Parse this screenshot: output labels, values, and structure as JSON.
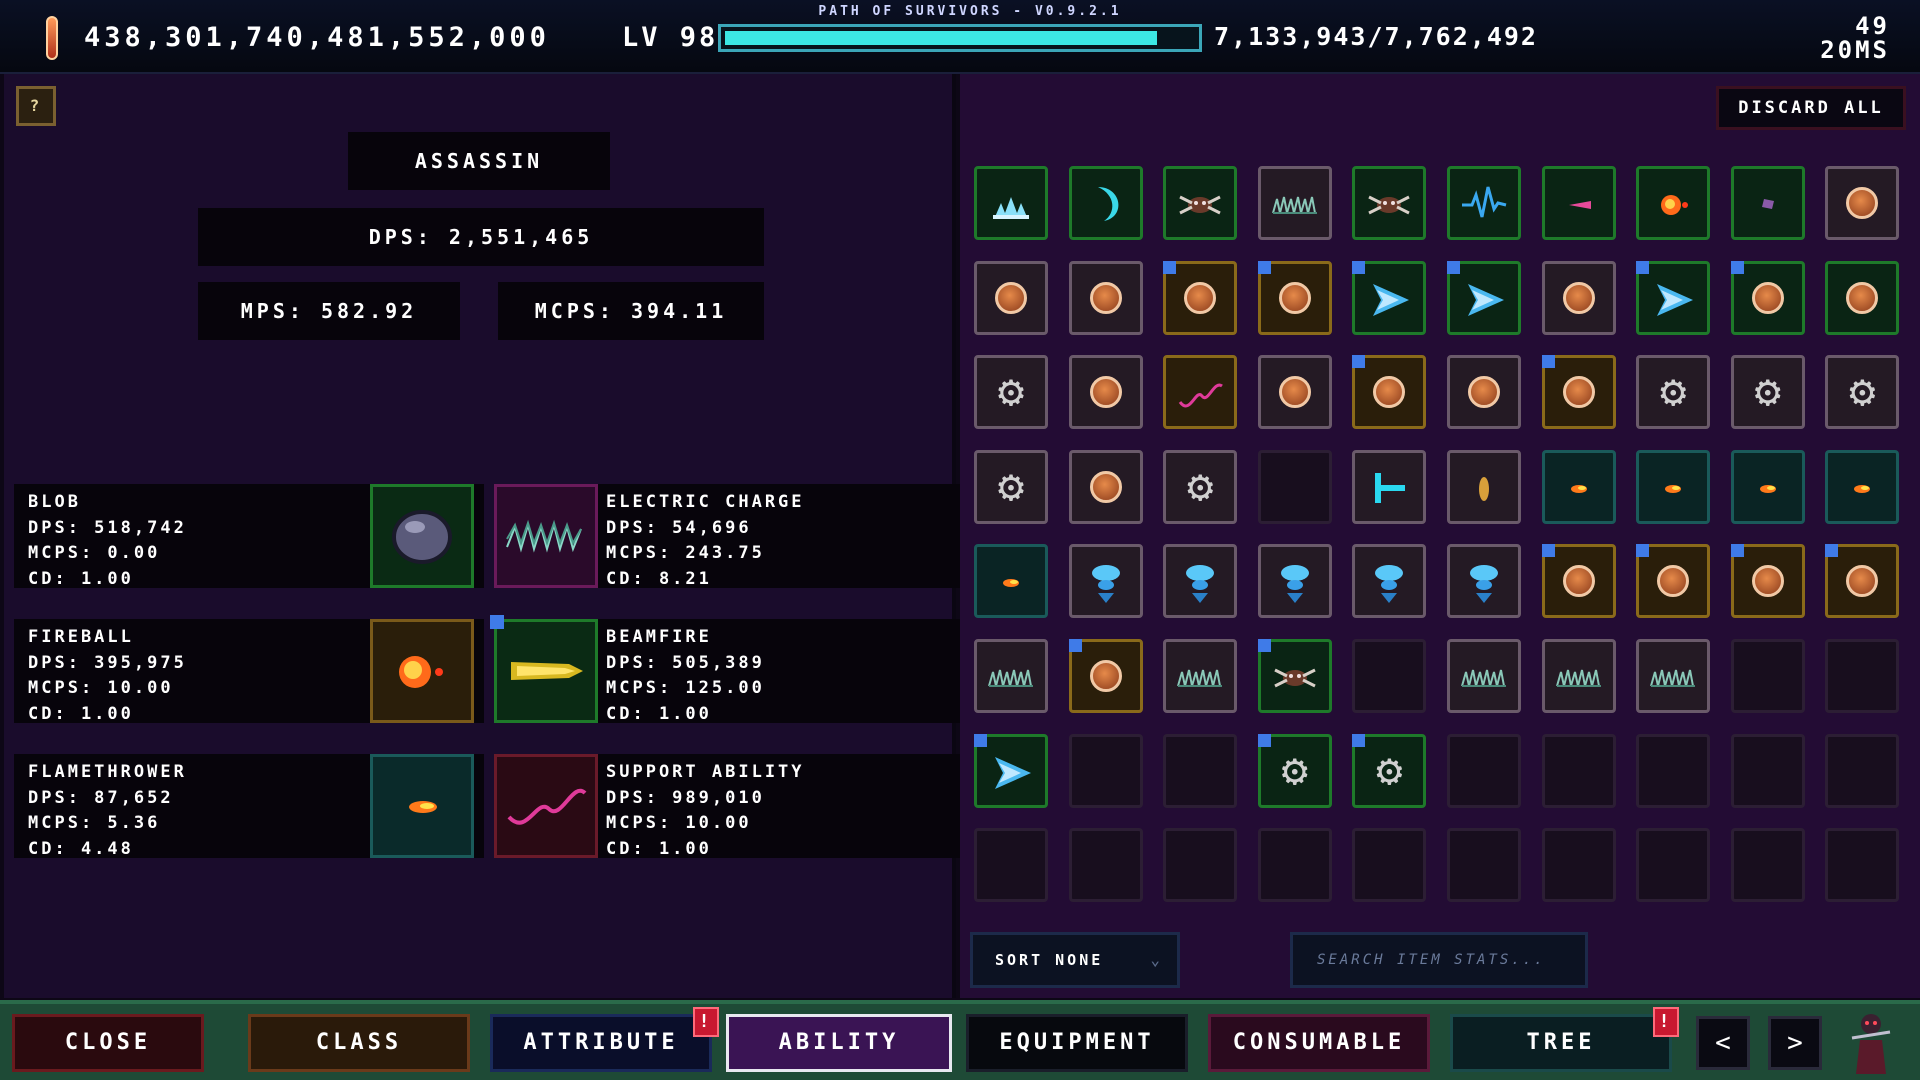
{
  "topbar": {
    "version": "PATH OF SURVIVORS - V0.9.2.1",
    "currency": "438,301,740,481,552,000",
    "level": "LV 98",
    "xp_text": "7,133,943/7,762,492",
    "xp_progress": 0.919,
    "fps_line1": "49",
    "fps_line2": "20MS"
  },
  "left": {
    "help_label": "?",
    "class_name": "ASSASSIN",
    "dps_total": "DPS: 2,551,465",
    "mps_total": "MPS: 582.92",
    "mcps_total": "MCPS: 394.11",
    "abilities": [
      {
        "name": "BLOB",
        "dps": "DPS: 518,742",
        "mcps": "MCPS: 0.00",
        "cd": "CD: 1.00"
      },
      {
        "name": "ELECTRIC CHARGE",
        "dps": "DPS: 54,696",
        "mcps": "MCPS: 243.75",
        "cd": "CD: 8.21"
      },
      {
        "name": "FIREBALL",
        "dps": "DPS: 395,975",
        "mcps": "MCPS: 10.00",
        "cd": "CD: 1.00"
      },
      {
        "name": "BEAMFIRE",
        "dps": "DPS: 505,389",
        "mcps": "MCPS: 125.00",
        "cd": "CD: 1.00"
      },
      {
        "name": "FLAMETHROWER",
        "dps": "DPS: 87,652",
        "mcps": "MCPS: 5.36",
        "cd": "CD: 4.48"
      },
      {
        "name": "SUPPORT ABILITY",
        "dps": "DPS: 989,010",
        "mcps": "MCPS: 10.00",
        "cd": "CD: 1.00"
      }
    ]
  },
  "right": {
    "discard_label": "DISCARD ALL",
    "sort_label": "SORT NONE",
    "search_placeholder": "SEARCH ITEM STATS..."
  },
  "nav": {
    "tabs": [
      {
        "label": "CLOSE",
        "badge": ""
      },
      {
        "label": "CLASS",
        "badge": ""
      },
      {
        "label": "ATTRIBUTE",
        "badge": "!"
      },
      {
        "label": "ABILITY",
        "badge": ""
      },
      {
        "label": "EQUIPMENT",
        "badge": ""
      },
      {
        "label": "CONSUMABLE",
        "badge": ""
      },
      {
        "label": "TREE",
        "badge": "!"
      }
    ],
    "prev_label": "<",
    "next_label": ">"
  }
}
